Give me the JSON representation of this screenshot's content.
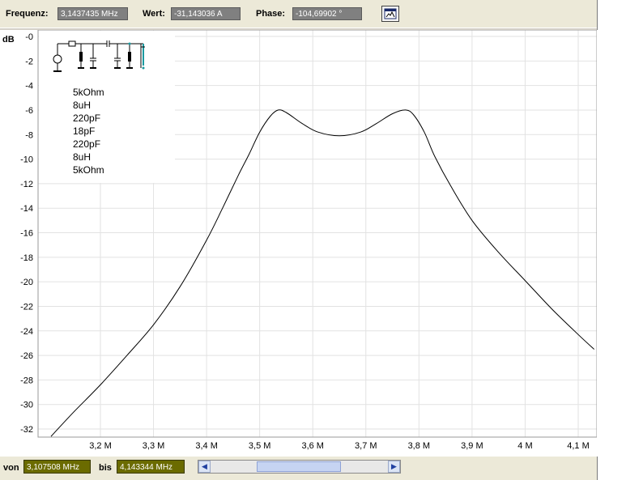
{
  "toolbar": {
    "frequency_label": "Frequenz:",
    "frequency_value": "3,1437435 MHz",
    "value_label": "Wert:",
    "value_value": "-31,143036 A",
    "phase_label": "Phase:",
    "phase_value": "-104,69902 °",
    "chart_icon": "chart-view-icon"
  },
  "legend": {
    "items": [
      "5kOhm",
      "8uH",
      "220pF",
      "18pF",
      "220pF",
      "8uH",
      "5kOhm"
    ]
  },
  "range": {
    "from_label": "von",
    "from_value": "3,107508 MHz",
    "to_label": "bis",
    "to_value": "4,143344 MHz"
  },
  "chart_data": {
    "type": "line",
    "ylabel": "dB",
    "xlabel": "",
    "ylim": [
      -33,
      0
    ],
    "xlim": [
      3.107508,
      4.143344
    ],
    "yticks": [
      "-0",
      "-2",
      "-4",
      "-6",
      "-8",
      "-10",
      "-12",
      "-14",
      "-16",
      "-18",
      "-20",
      "-22",
      "-24",
      "-26",
      "-28",
      "-30",
      "-32"
    ],
    "xticks": [
      "3,2 M",
      "3,3 M",
      "3,4 M",
      "3,5 M",
      "3,6 M",
      "3,7 M",
      "3,8 M",
      "3,9 M",
      "4 M",
      "4,1 M"
    ],
    "grid": true,
    "series": [
      {
        "x": [
          3.107,
          3.15,
          3.2,
          3.25,
          3.3,
          3.35,
          3.4,
          3.43,
          3.46,
          3.48,
          3.5,
          3.52,
          3.535,
          3.55,
          3.58,
          3.61,
          3.65,
          3.69,
          3.72,
          3.75,
          3.775,
          3.79,
          3.81,
          3.83,
          3.86,
          3.9,
          3.95,
          4.0,
          4.05,
          4.1,
          4.13
        ],
        "y": [
          -32.6,
          -30.6,
          -28.4,
          -26.0,
          -23.5,
          -20.4,
          -16.6,
          -14.0,
          -11.3,
          -9.6,
          -7.8,
          -6.5,
          -6.0,
          -6.2,
          -7.1,
          -7.8,
          -8.1,
          -7.8,
          -7.1,
          -6.3,
          -6.0,
          -6.4,
          -7.8,
          -9.8,
          -12.2,
          -15.0,
          -17.6,
          -19.9,
          -22.2,
          -24.3,
          -25.5
        ]
      }
    ]
  }
}
